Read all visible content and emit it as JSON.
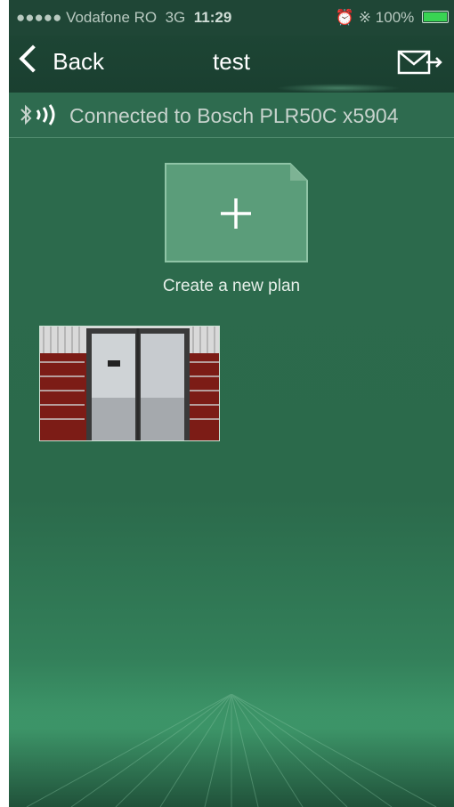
{
  "status_bar": {
    "carrier": "●●●●● Vodafone RO",
    "network": "3G",
    "time": "11:29",
    "battery": "100%"
  },
  "nav": {
    "back_label": "Back",
    "title": "test"
  },
  "connection": {
    "text": "Connected to Bosch PLR50C x5904"
  },
  "new_plan": {
    "label": "Create a new plan"
  },
  "plans": [
    {
      "thumbnail": "door-photo"
    }
  ],
  "colors": {
    "background": "#2b6a4b",
    "navbar": "#1a3f30",
    "accent_battery": "#39d353"
  }
}
